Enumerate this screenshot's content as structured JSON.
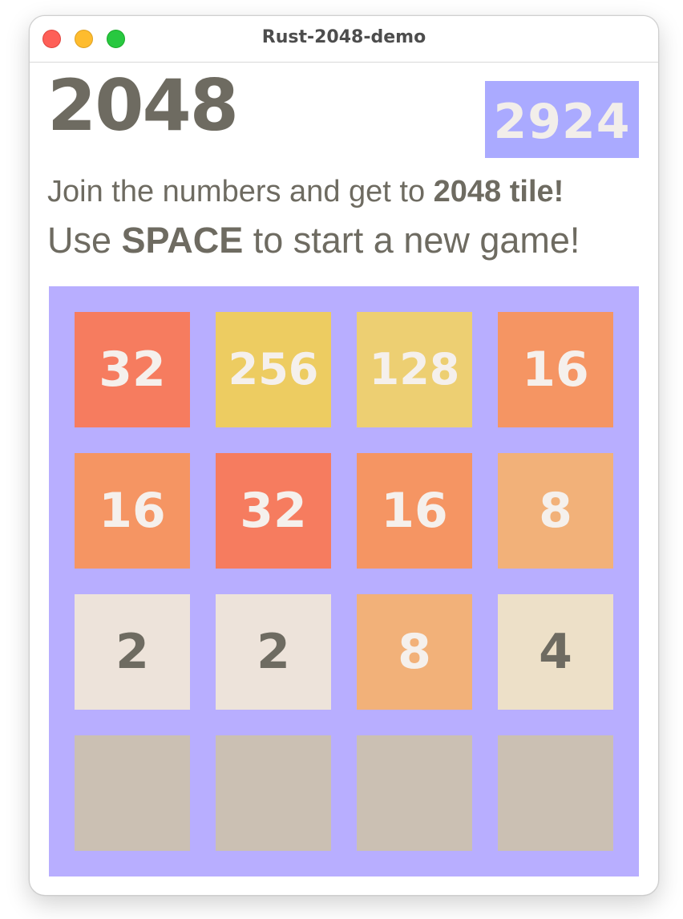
{
  "window": {
    "title": "Rust-2048-demo"
  },
  "header": {
    "game_title": "2048",
    "score": "2924"
  },
  "instructions": {
    "line1_pre": "Join the numbers and get to ",
    "line1_bold": "2048 tile!",
    "line2_pre": "Use ",
    "line2_bold": "SPACE",
    "line2_post": " to start a new game!"
  },
  "colors": {
    "board_background": "#b8aeff",
    "score_background": "#aaaaff",
    "empty_tile": "#cbc0b3",
    "dark_text": "#6e6b61",
    "light_text": "#f5f0ec",
    "tile_2": "#ede3da",
    "tile_4": "#ede0c8",
    "tile_8": "#f2b179",
    "tile_16": "#f59563",
    "tile_32": "#f67c5f",
    "tile_128": "#edcf72",
    "tile_256": "#edcc61"
  },
  "board": [
    [
      "32",
      "256",
      "128",
      "16"
    ],
    [
      "16",
      "32",
      "16",
      "8"
    ],
    [
      "2",
      "2",
      "8",
      "4"
    ],
    [
      "",
      "",
      "",
      ""
    ]
  ]
}
